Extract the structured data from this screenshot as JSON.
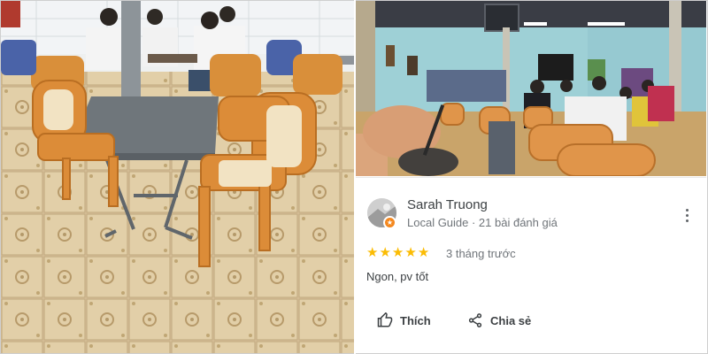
{
  "review": {
    "author_name": "Sarah Truong",
    "author_subtitle": "Local Guide · 21 bài đánh giá",
    "rating": 5,
    "time_ago": "3 tháng trước",
    "text": "Ngon, pv tốt"
  },
  "actions": {
    "like_label": "Thích",
    "share_label": "Chia sẻ"
  },
  "icons": {
    "star": "star-icon",
    "more": "more-vert-icon",
    "like": "thumb-up-icon",
    "share": "share-icon",
    "badge": "local-guide-badge-icon"
  },
  "colors": {
    "star": "#fbbc04",
    "badge": "#f4881f",
    "text_primary": "#3c4043",
    "text_secondary": "#70757a"
  }
}
